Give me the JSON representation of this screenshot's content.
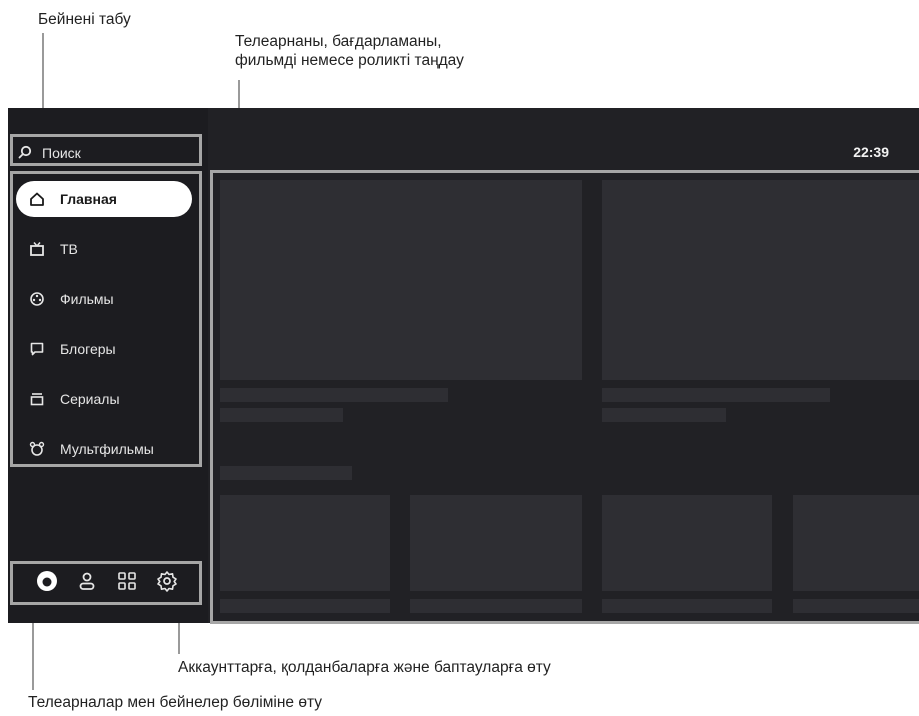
{
  "annotations": {
    "video_search": "Бейнені табу",
    "choose_content_line1": "Телеарнаны, бағдарламаны,",
    "choose_content_line2": "фильмді немесе роликті таңдау",
    "accounts_apps_settings": "Аккаунттарға, қолданбаларға және баптауларға өту",
    "channels_videos_section": "Телеарналар мен бейнелер бөліміне өту"
  },
  "search": {
    "label": "Поиск",
    "icon": "search-icon"
  },
  "clock": "22:39",
  "nav": {
    "items": [
      {
        "label": "Главная",
        "icon": "home-icon",
        "active": true
      },
      {
        "label": "ТВ",
        "icon": "tv-icon",
        "active": false
      },
      {
        "label": "Фильмы",
        "icon": "film-reel-icon",
        "active": false
      },
      {
        "label": "Блогеры",
        "icon": "chat-icon",
        "active": false
      },
      {
        "label": "Сериалы",
        "icon": "series-icon",
        "active": false
      },
      {
        "label": "Мультфильмы",
        "icon": "cartoon-icon",
        "active": false
      }
    ]
  },
  "bottom_icons": [
    "alice-icon",
    "account-icon",
    "apps-grid-icon",
    "settings-gear-icon"
  ],
  "colors": {
    "screen_bg": "#212125",
    "sidebar_bg": "#1c1c20",
    "placeholder": "#2e2e33",
    "highlight_box": "#a6a6a6",
    "active_pill": "#ffffff"
  }
}
